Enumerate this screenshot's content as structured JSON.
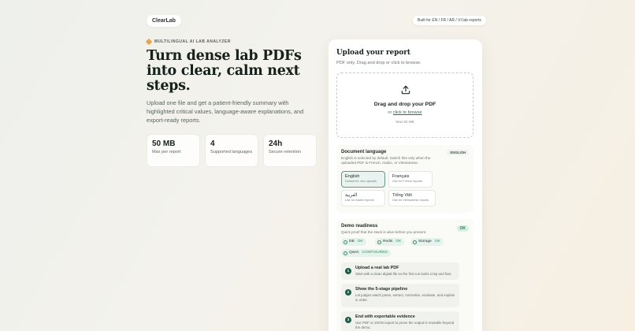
{
  "brand": "ClearLab",
  "built_for": "Built for EN / FR / AR / VI lab reports",
  "hero": {
    "eyebrow": "MULTILINGUAL AI LAB ANALYZER",
    "title": "Turn dense lab PDFs into clear, calm next steps.",
    "subtitle": "Upload one file and get a patient-friendly summary with highlighted critical values, language-aware explanations, and export-ready reports."
  },
  "stats": [
    {
      "value": "50 MB",
      "label": "Max per report"
    },
    {
      "value": "4",
      "label": "Supported languages"
    },
    {
      "value": "24h",
      "label": "Secure retention"
    }
  ],
  "upload": {
    "title": "Upload your report",
    "hint": "PDF only. Drag and drop or click to browse.",
    "drop_title": "Drag and drop your PDF",
    "or": "or",
    "browse": "click to browse",
    "max": "Max 50 MB"
  },
  "language": {
    "title": "Document language",
    "desc": "English is selected by default. Switch this only when the uploaded PDF is French, Arabic, or Vietnamese.",
    "badge": "ENGLISH",
    "options": [
      {
        "name": "English",
        "desc": "Default for new uploads"
      },
      {
        "name": "Français",
        "desc": "Use for French reports"
      },
      {
        "name": "العربية",
        "desc": "Use for Arabic reports"
      },
      {
        "name": "Tiếng Việt",
        "desc": "Use for Vietnamese reports"
      }
    ]
  },
  "readiness": {
    "title": "Demo readiness",
    "desc": "Quick proof that the stack is alive before you present.",
    "badge": "OK",
    "chips": [
      {
        "name": "DB",
        "status": "OK"
      },
      {
        "name": "Redis",
        "status": "OK"
      },
      {
        "name": "Storage",
        "status": "OK"
      },
      {
        "name": "Qwen",
        "status": "CONFIGURED"
      }
    ],
    "steps": [
      {
        "num": "1",
        "title": "Upload a real lab PDF",
        "desc": "Start with a clean digital file so the first run looks crisp and fast."
      },
      {
        "num": "2",
        "title": "Show the 5-stage pipeline",
        "desc": "Let judges watch parse, extract, normalize, evaluate, and explain in order."
      },
      {
        "num": "3",
        "title": "End with exportable evidence",
        "desc": "Use PDF or JSON export to prove the output is reusable beyond the demo."
      }
    ]
  },
  "colors": {
    "accent": "#1d5e4a",
    "ok": "#3c8a6f",
    "warm": "#e8a54a"
  }
}
